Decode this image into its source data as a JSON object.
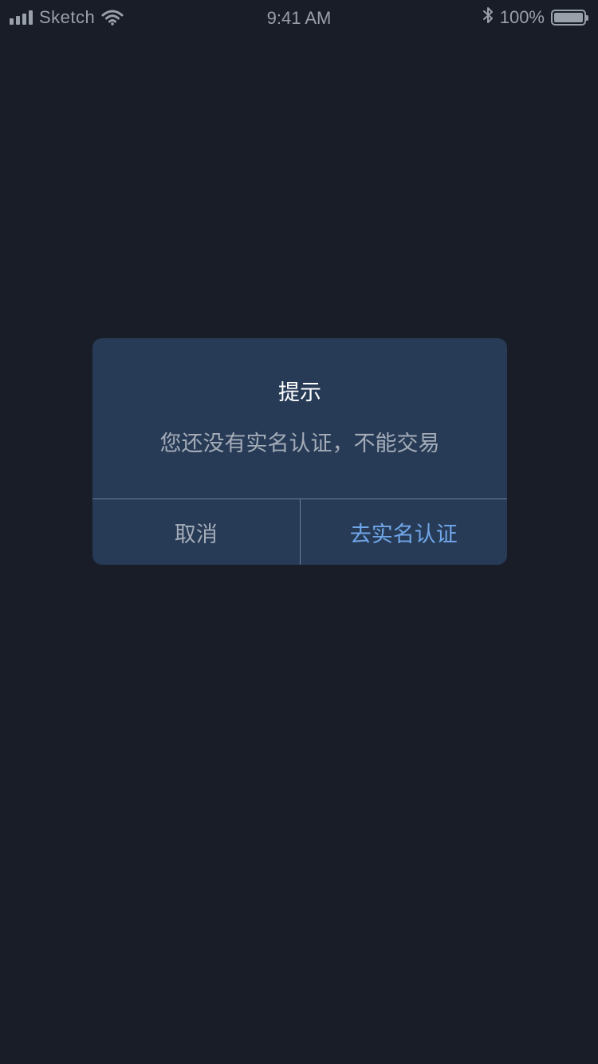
{
  "status_bar": {
    "carrier": "Sketch",
    "time": "9:41 AM",
    "battery_percent_label": "100%",
    "battery_level": 1.0,
    "icons": {
      "signal": "signal-bars-icon",
      "wifi": "wifi-icon",
      "bluetooth": "bluetooth-icon",
      "battery": "battery-icon"
    }
  },
  "alert": {
    "title": "提示",
    "message": "您还没有实名认证，不能交易",
    "cancel_label": "取消",
    "confirm_label": "去实名认证"
  },
  "colors": {
    "background": "#181d28",
    "dialog_background": "#283b56",
    "confirm_text": "#6fa7ea",
    "secondary_text": "#a4acb8",
    "divider": "#6a7f9a"
  }
}
